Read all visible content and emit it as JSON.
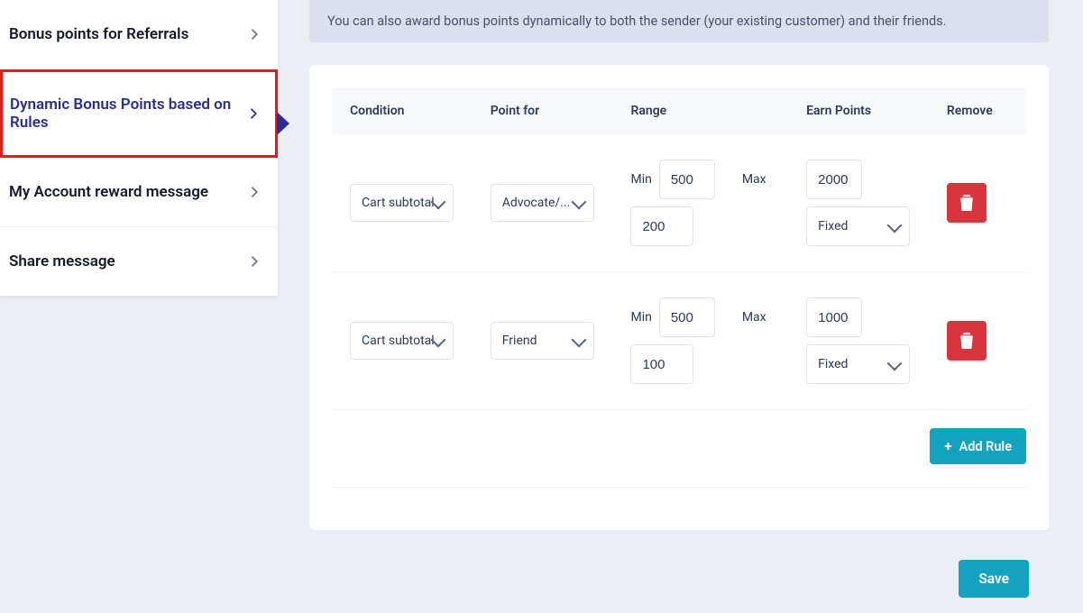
{
  "sidebar": {
    "items": [
      {
        "label": "Bonus points for Referrals",
        "active": false
      },
      {
        "label": "Dynamic Bonus Points based on Rules",
        "active": true
      },
      {
        "label": "My Account reward message",
        "active": false
      },
      {
        "label": "Share message",
        "active": false
      }
    ]
  },
  "info_text": "You can also award bonus points dynamically to both the sender (your existing customer) and their friends.",
  "columns": {
    "condition": "Condition",
    "point_for": "Point for",
    "range": "Range",
    "earn": "Earn Points",
    "remove": "Remove"
  },
  "range_labels": {
    "min": "Min",
    "max": "Max"
  },
  "rules": [
    {
      "condition": "Cart subtotal",
      "point_for": "Advocate/...",
      "min": "500",
      "extra": "200",
      "earn_value": "2000",
      "earn_type": "Fixed"
    },
    {
      "condition": "Cart subtotal",
      "point_for": "Friend",
      "min": "500",
      "extra": "100",
      "earn_value": "1000",
      "earn_type": "Fixed"
    }
  ],
  "buttons": {
    "add_rule": "Add Rule",
    "save": "Save"
  }
}
